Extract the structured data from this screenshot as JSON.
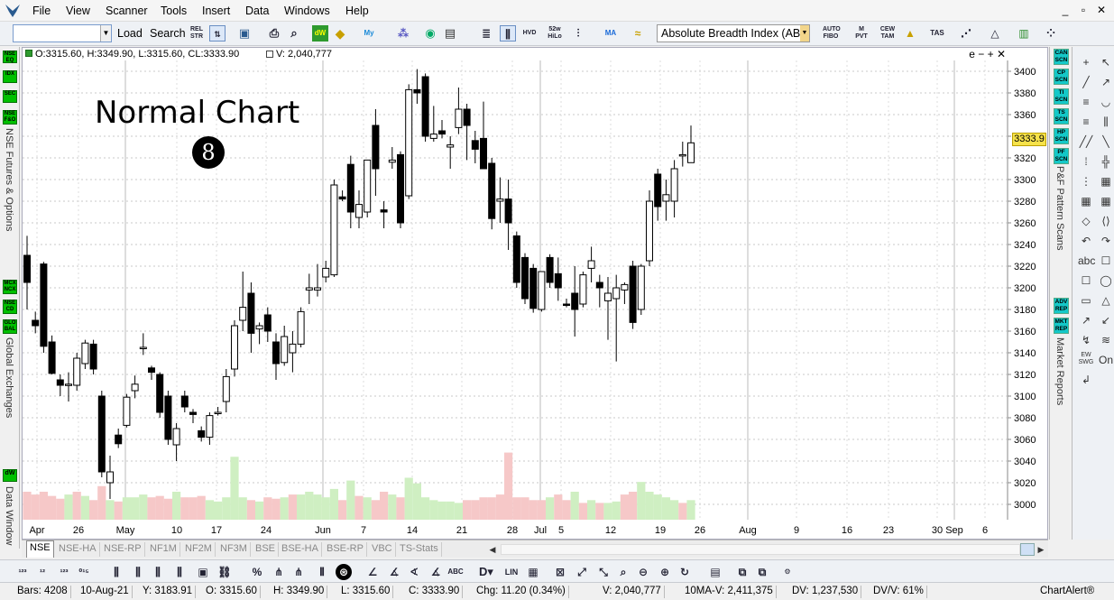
{
  "menu": {
    "items": [
      "File",
      "View",
      "Scanner",
      "Tools",
      "Insert",
      "Data",
      "Windows",
      "Help"
    ],
    "window_controls": [
      "_",
      "▫",
      "✕"
    ]
  },
  "toolbar": {
    "symbol_value": "",
    "load_label": "Load",
    "search_label": "Search",
    "rel_str_label": "REL STR",
    "52w_label": "52w HiLo",
    "indicator_value": "Absolute Breadth Index (AB",
    "auto_fibo": "AUTO FIBO",
    "m_pvt": "M PVT",
    "cew_tam": "CEW TAM",
    "tas": "TAS"
  },
  "left_tabs": {
    "buttons_top": [
      "NSE EQ",
      "IDX",
      "SEC",
      "NSE F&O"
    ],
    "label_top": "NSE Futures & Options",
    "buttons_mid": [
      "MCX NCX",
      "NSE CD",
      "GLO BAL"
    ],
    "label_mid": "Global Exchanges",
    "buttons_bot": [
      "dW"
    ],
    "label_bot": "Data Window"
  },
  "chart_header": {
    "ohlc": "O:3315.60, H:3349.90, L:3315.60, CL:3333.90",
    "volume": "V: 2,040,777",
    "controls": "e − + ✕"
  },
  "annotation": {
    "title": "Normal Chart",
    "number": "8"
  },
  "price_badge": "3333.9",
  "chart_data": {
    "type": "candlestick",
    "title": "",
    "ylim": [
      2990,
      3410
    ],
    "y_ticks": [
      3000,
      3020,
      3040,
      3060,
      3080,
      3100,
      3120,
      3140,
      3160,
      3180,
      3200,
      3220,
      3240,
      3260,
      3280,
      3300,
      3320,
      3340,
      3360,
      3380,
      3400
    ],
    "x_tick_labels": [
      "Apr",
      "26",
      "May",
      "10",
      "17",
      "24",
      "Jun",
      "7",
      "14",
      "21",
      "28",
      "Jul",
      "5",
      "12",
      "19",
      "26",
      "Aug",
      "9",
      "16",
      "23",
      "30",
      "Sep",
      "6"
    ],
    "candles": [
      {
        "o": 3230,
        "h": 3248,
        "l": 3180,
        "c": 3205
      },
      {
        "o": 3170,
        "h": 3178,
        "l": 3158,
        "c": 3165
      },
      {
        "o": 3222,
        "h": 3224,
        "l": 3140,
        "c": 3146
      },
      {
        "o": 3150,
        "h": 3156,
        "l": 3120,
        "c": 3121
      },
      {
        "o": 3115,
        "h": 3120,
        "l": 3100,
        "c": 3110
      },
      {
        "o": 3110,
        "h": 3122,
        "l": 3095,
        "c": 3111
      },
      {
        "o": 3110,
        "h": 3140,
        "l": 3105,
        "c": 3135
      },
      {
        "o": 3130,
        "h": 3152,
        "l": 3125,
        "c": 3149
      },
      {
        "o": 3148,
        "h": 3152,
        "l": 3120,
        "c": 3125
      },
      {
        "o": 3100,
        "h": 3105,
        "l": 3025,
        "c": 3030
      },
      {
        "o": 3020,
        "h": 3045,
        "l": 3005,
        "c": 3030
      },
      {
        "o": 3064,
        "h": 3070,
        "l": 3052,
        "c": 3056
      },
      {
        "o": 3073,
        "h": 3102,
        "l": 3071,
        "c": 3099
      },
      {
        "o": 3105,
        "h": 3119,
        "l": 3098,
        "c": 3111
      },
      {
        "o": 3145,
        "h": 3158,
        "l": 3138,
        "c": 3145
      },
      {
        "o": 3126,
        "h": 3128,
        "l": 3115,
        "c": 3122
      },
      {
        "o": 3120,
        "h": 3122,
        "l": 3080,
        "c": 3085
      },
      {
        "o": 3100,
        "h": 3105,
        "l": 3055,
        "c": 3060
      },
      {
        "o": 3055,
        "h": 3075,
        "l": 3040,
        "c": 3070
      },
      {
        "o": 3100,
        "h": 3105,
        "l": 3085,
        "c": 3090
      },
      {
        "o": 3085,
        "h": 3088,
        "l": 3075,
        "c": 3083
      },
      {
        "o": 3068,
        "h": 3072,
        "l": 3058,
        "c": 3062
      },
      {
        "o": 3062,
        "h": 3085,
        "l": 3055,
        "c": 3082
      },
      {
        "o": 3085,
        "h": 3090,
        "l": 3082,
        "c": 3085
      },
      {
        "o": 3095,
        "h": 3125,
        "l": 3085,
        "c": 3118
      },
      {
        "o": 3125,
        "h": 3170,
        "l": 3118,
        "c": 3165
      },
      {
        "o": 3170,
        "h": 3215,
        "l": 3160,
        "c": 3182
      },
      {
        "o": 3195,
        "h": 3205,
        "l": 3140,
        "c": 3158
      },
      {
        "o": 3162,
        "h": 3168,
        "l": 3148,
        "c": 3165
      },
      {
        "o": 3175,
        "h": 3182,
        "l": 3150,
        "c": 3160
      },
      {
        "o": 3150,
        "h": 3158,
        "l": 3115,
        "c": 3130
      },
      {
        "o": 3131,
        "h": 3165,
        "l": 3128,
        "c": 3155
      },
      {
        "o": 3140,
        "h": 3160,
        "l": 3122,
        "c": 3148
      },
      {
        "o": 3148,
        "h": 3182,
        "l": 3145,
        "c": 3178
      },
      {
        "o": 3198,
        "h": 3213,
        "l": 3185,
        "c": 3200
      },
      {
        "o": 3198,
        "h": 3222,
        "l": 3192,
        "c": 3200
      },
      {
        "o": 3210,
        "h": 3225,
        "l": 3205,
        "c": 3218
      },
      {
        "o": 3212,
        "h": 3300,
        "l": 3210,
        "c": 3295
      },
      {
        "o": 3284,
        "h": 3290,
        "l": 3280,
        "c": 3282
      },
      {
        "o": 3314,
        "h": 3322,
        "l": 3255,
        "c": 3270
      },
      {
        "o": 3265,
        "h": 3290,
        "l": 3255,
        "c": 3277
      },
      {
        "o": 3270,
        "h": 3298,
        "l": 3265,
        "c": 3318
      },
      {
        "o": 3350,
        "h": 3365,
        "l": 3285,
        "c": 3310
      },
      {
        "o": 3272,
        "h": 3280,
        "l": 3255,
        "c": 3270
      },
      {
        "o": 3316,
        "h": 3330,
        "l": 3310,
        "c": 3318
      },
      {
        "o": 3323,
        "h": 3326,
        "l": 3255,
        "c": 3260
      },
      {
        "o": 3285,
        "h": 3388,
        "l": 3282,
        "c": 3383
      },
      {
        "o": 3383,
        "h": 3402,
        "l": 3370,
        "c": 3380
      },
      {
        "o": 3395,
        "h": 3398,
        "l": 3335,
        "c": 3340
      },
      {
        "o": 3338,
        "h": 3368,
        "l": 3335,
        "c": 3342
      },
      {
        "o": 3345,
        "h": 3355,
        "l": 3338,
        "c": 3342
      },
      {
        "o": 3330,
        "h": 3340,
        "l": 3310,
        "c": 3332
      },
      {
        "o": 3348,
        "h": 3385,
        "l": 3342,
        "c": 3365
      },
      {
        "o": 3365,
        "h": 3370,
        "l": 3318,
        "c": 3350
      },
      {
        "o": 3336,
        "h": 3345,
        "l": 3315,
        "c": 3328
      },
      {
        "o": 3338,
        "h": 3372,
        "l": 3330,
        "c": 3310
      },
      {
        "o": 3315,
        "h": 3320,
        "l": 3254,
        "c": 3264
      },
      {
        "o": 3280,
        "h": 3302,
        "l": 3260,
        "c": 3282
      },
      {
        "o": 3282,
        "h": 3300,
        "l": 3235,
        "c": 3260
      },
      {
        "o": 3248,
        "h": 3252,
        "l": 3200,
        "c": 3205
      },
      {
        "o": 3228,
        "h": 3232,
        "l": 3185,
        "c": 3190
      },
      {
        "o": 3218,
        "h": 3222,
        "l": 3177,
        "c": 3181
      },
      {
        "o": 3180,
        "h": 3205,
        "l": 3178,
        "c": 3215
      },
      {
        "o": 3228,
        "h": 3231,
        "l": 3200,
        "c": 3205
      },
      {
        "o": 3213,
        "h": 3228,
        "l": 3188,
        "c": 3200
      },
      {
        "o": 3185,
        "h": 3190,
        "l": 3182,
        "c": 3184
      },
      {
        "o": 3195,
        "h": 3220,
        "l": 3155,
        "c": 3180
      },
      {
        "o": 3185,
        "h": 3215,
        "l": 3182,
        "c": 3212
      },
      {
        "o": 3218,
        "h": 3238,
        "l": 3205,
        "c": 3225
      },
      {
        "o": 3205,
        "h": 3212,
        "l": 3182,
        "c": 3200
      },
      {
        "o": 3188,
        "h": 3210,
        "l": 3152,
        "c": 3195
      },
      {
        "o": 3190,
        "h": 3212,
        "l": 3132,
        "c": 3200
      },
      {
        "o": 3198,
        "h": 3205,
        "l": 3185,
        "c": 3203
      },
      {
        "o": 3220,
        "h": 3225,
        "l": 3162,
        "c": 3168
      },
      {
        "o": 3180,
        "h": 3222,
        "l": 3175,
        "c": 3220
      },
      {
        "o": 3225,
        "h": 3290,
        "l": 3220,
        "c": 3280
      },
      {
        "o": 3305,
        "h": 3310,
        "l": 3262,
        "c": 3275
      },
      {
        "o": 3280,
        "h": 3300,
        "l": 3262,
        "c": 3286
      },
      {
        "o": 3280,
        "h": 3318,
        "l": 3265,
        "c": 3310
      },
      {
        "o": 3322,
        "h": 3335,
        "l": 3312,
        "c": 3323
      },
      {
        "o": 3315.6,
        "h": 3349.9,
        "l": 3315.6,
        "c": 3333.9
      }
    ],
    "volume": [
      {
        "v": 20,
        "up": false
      },
      {
        "v": 18,
        "up": false
      },
      {
        "v": 20,
        "up": false
      },
      {
        "v": 17,
        "up": false
      },
      {
        "v": 15,
        "up": false
      },
      {
        "v": 18,
        "up": true
      },
      {
        "v": 20,
        "up": false
      },
      {
        "v": 17,
        "up": true
      },
      {
        "v": 14,
        "up": false
      },
      {
        "v": 24,
        "up": false
      },
      {
        "v": 14,
        "up": true
      },
      {
        "v": 13,
        "up": false
      },
      {
        "v": 16,
        "up": true
      },
      {
        "v": 16,
        "up": true
      },
      {
        "v": 18,
        "up": true
      },
      {
        "v": 16,
        "up": false
      },
      {
        "v": 17,
        "up": false
      },
      {
        "v": 15,
        "up": false
      },
      {
        "v": 20,
        "up": true
      },
      {
        "v": 16,
        "up": false
      },
      {
        "v": 16,
        "up": false
      },
      {
        "v": 17,
        "up": false
      },
      {
        "v": 14,
        "up": true
      },
      {
        "v": 13,
        "up": true
      },
      {
        "v": 16,
        "up": true
      },
      {
        "v": 45,
        "up": true
      },
      {
        "v": 16,
        "up": true
      },
      {
        "v": 14,
        "up": false
      },
      {
        "v": 13,
        "up": true
      },
      {
        "v": 16,
        "up": false
      },
      {
        "v": 15,
        "up": false
      },
      {
        "v": 16,
        "up": true
      },
      {
        "v": 18,
        "up": false
      },
      {
        "v": 18,
        "up": true
      },
      {
        "v": 20,
        "up": true
      },
      {
        "v": 18,
        "up": true
      },
      {
        "v": 16,
        "up": true
      },
      {
        "v": 22,
        "up": true
      },
      {
        "v": 14,
        "up": false
      },
      {
        "v": 28,
        "up": true
      },
      {
        "v": 17,
        "up": false
      },
      {
        "v": 16,
        "up": true
      },
      {
        "v": 14,
        "up": false
      },
      {
        "v": 20,
        "up": false
      },
      {
        "v": 18,
        "up": true
      },
      {
        "v": 16,
        "up": false
      },
      {
        "v": 30,
        "up": true
      },
      {
        "v": 26,
        "up": true
      },
      {
        "v": 16,
        "up": true
      },
      {
        "v": 14,
        "up": true
      },
      {
        "v": 13,
        "up": true
      },
      {
        "v": 13,
        "up": true
      },
      {
        "v": 12,
        "up": true
      },
      {
        "v": 14,
        "up": false
      },
      {
        "v": 14,
        "up": false
      },
      {
        "v": 16,
        "up": false
      },
      {
        "v": 16,
        "up": false
      },
      {
        "v": 18,
        "up": false
      },
      {
        "v": 48,
        "up": false
      },
      {
        "v": 16,
        "up": false
      },
      {
        "v": 16,
        "up": false
      },
      {
        "v": 14,
        "up": false
      },
      {
        "v": 14,
        "up": false
      },
      {
        "v": 16,
        "up": true
      },
      {
        "v": 18,
        "up": false
      },
      {
        "v": 14,
        "up": false
      },
      {
        "v": 20,
        "up": true
      },
      {
        "v": 12,
        "up": false
      },
      {
        "v": 14,
        "up": true
      },
      {
        "v": 12,
        "up": false
      },
      {
        "v": 12,
        "up": true
      },
      {
        "v": 13,
        "up": true
      },
      {
        "v": 18,
        "up": false
      },
      {
        "v": 20,
        "up": false
      },
      {
        "v": 27,
        "up": true
      },
      {
        "v": 20,
        "up": true
      },
      {
        "v": 18,
        "up": true
      },
      {
        "v": 16,
        "up": true
      },
      {
        "v": 14,
        "up": true
      },
      {
        "v": 12,
        "up": false
      },
      {
        "v": 14,
        "up": true
      }
    ],
    "up_color": "#000000",
    "vol_up_color": "#cfefc2",
    "vol_down_color": "#f6c8c8",
    "grid": true
  },
  "bottom_tabs": [
    "NSE",
    "NSE-HA",
    "NSE-RP",
    "NF1M",
    "NF2M",
    "NF3M",
    "BSE",
    "BSE-HA",
    "BSE-RP",
    "VBC",
    "TS-Stats"
  ],
  "right_panel": {
    "scan_buttons": [
      "CAN SCN",
      "CP SCN",
      "TI SCN",
      "TS SCN",
      "HP SCN",
      "PF SCN"
    ],
    "scan_label": "P&F Pattern Scans",
    "report_buttons": [
      "ADV REP",
      "MKT REP"
    ],
    "report_label": "Market Reports"
  },
  "draw_tools": {
    "labels": [
      "+",
      "↖",
      "╱",
      "↗",
      "≡",
      "◡",
      "≡",
      "⫼",
      "╱╱",
      "╲",
      "⁞",
      "╬",
      "⋮",
      "▦",
      "▦",
      "▦",
      "◇",
      "⟨⟩",
      "↶",
      "↷",
      "abc",
      "☐",
      "☐",
      "◯",
      "▭",
      "△",
      "↗",
      "↙",
      "↯",
      "≋",
      "EW SWG",
      "On",
      "↲"
    ]
  },
  "statusbar": {
    "bars": "Bars: 4208",
    "date": "10-Aug-21",
    "y": "Y: 3183.91",
    "o": "O: 3315.60",
    "h": "H: 3349.90",
    "l": "L: 3315.60",
    "c": "C: 3333.90",
    "chg": "Chg: 11.20 (0.34%)",
    "v": "V: 2,040,777",
    "ma": "10MA-V: 2,411,375",
    "dv": "DV: 1,237,530",
    "dvv": "DV/V: 61%",
    "app": "ChartAlert®"
  }
}
